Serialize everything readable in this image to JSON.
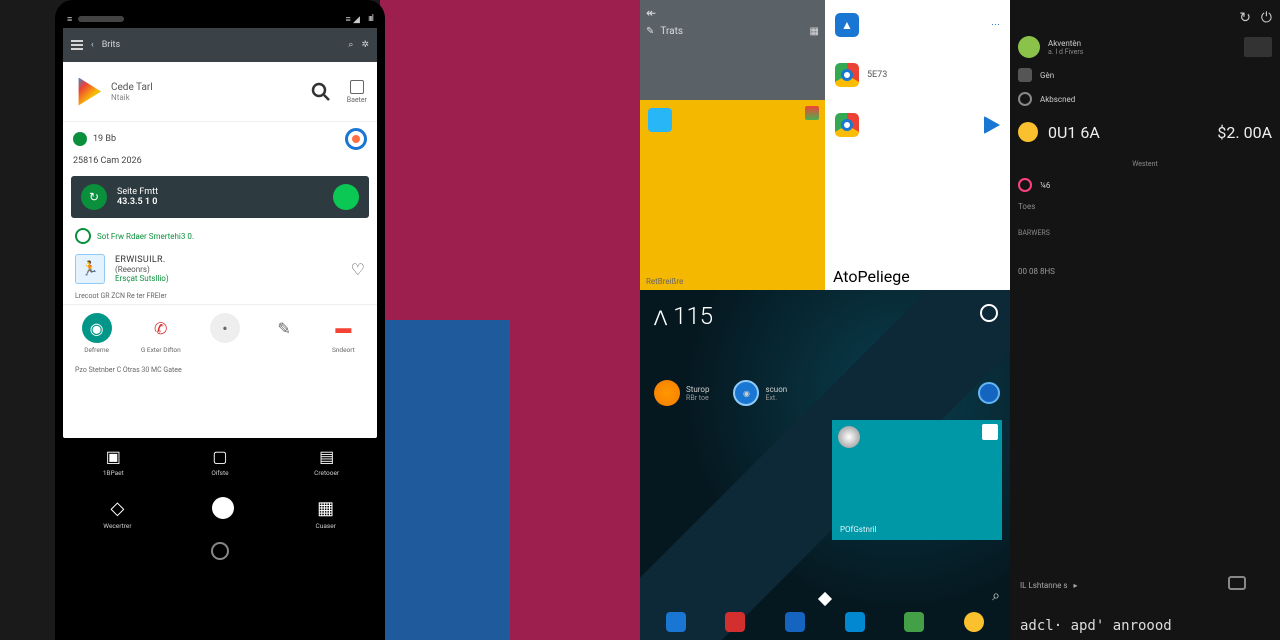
{
  "phone": {
    "status": {
      "left_icon": "≡",
      "right_icons": "≡ ◢ ⫼"
    },
    "appbar": {
      "back_label": "Brits"
    },
    "header": {
      "title": "Cede Tarl",
      "subtitle": "Ntaik",
      "baser": "Baeter"
    },
    "info": {
      "pct": "19 Bb",
      "date": "25816 Cam  2026"
    },
    "card": {
      "title": "Seite Fmtt",
      "value": "43.3.5 1 0"
    },
    "status_line": "Sot Frw Rdaer Smertehi3 0.",
    "app": {
      "name": "ERWISUILR.",
      "sub": "(Reeonrs)",
      "extra": "Ersçat Sutsllio)"
    },
    "footnote": "Lrecoot GR ZCN Re ter FREIer",
    "quick": [
      {
        "label": "Defrerne"
      },
      {
        "label": "G Exter Difton"
      },
      {
        "label": ""
      },
      {
        "label": ""
      },
      {
        "label": "Sndeort"
      }
    ],
    "bottomnav": [
      {
        "label": "1BPaet"
      },
      {
        "label": "Oifste"
      },
      {
        "label": "Cretooer"
      }
    ],
    "dock": [
      {
        "label": "Wecertrer"
      },
      {
        "label": ""
      },
      {
        "label": "Cuaser"
      }
    ],
    "footer_small": "Pzo Stetnber C Otras 30 MC Gatee"
  },
  "tablet": {
    "top": {
      "grey_label": "Trats",
      "apps": [
        {
          "name": ""
        },
        {
          "name": "5E73"
        },
        {
          "name": ""
        }
      ],
      "yellow_label": "RetBreißre",
      "white_label": "AtoPeliege"
    },
    "home": {
      "time": "115",
      "apps": [
        {
          "name": "Sturop",
          "sub": "RBr toe"
        },
        {
          "name": "scuon",
          "sub": "Ext."
        }
      ],
      "widget_label": "POfGstnril"
    }
  },
  "panel": {
    "account": {
      "name": "Akventèn",
      "sub": "a. I d Fivers"
    },
    "rows": [
      {
        "label": "Gèn"
      },
      {
        "label": "Akbscned"
      }
    ],
    "balance": {
      "amt1": "0U1   6A",
      "amt2": "$2. 00A"
    },
    "sec1": "Westent",
    "items": [
      {
        "label": "¼6"
      },
      {
        "label": "Toes"
      }
    ],
    "sec2": "BARWERS",
    "timestamp": "00 08 8HS",
    "bottom_label": "IL Lshtanne s",
    "cmd": "adcl·  apd'  anroood"
  }
}
